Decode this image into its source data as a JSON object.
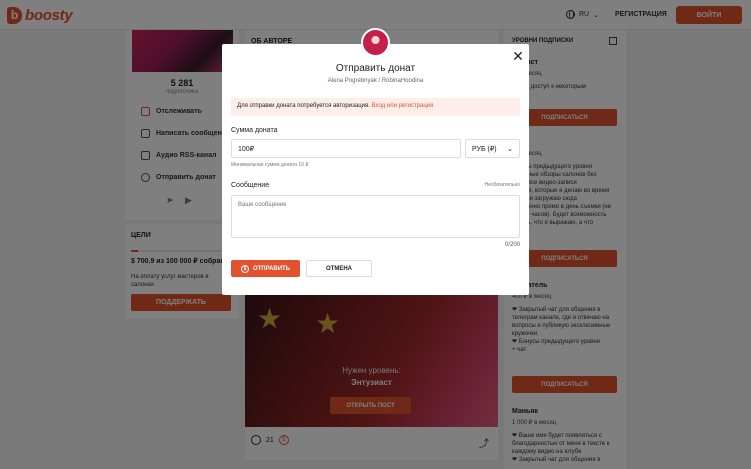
{
  "header": {
    "logo_text": "boosty",
    "language": "RU",
    "register_label": "РЕГИСТРАЦИЯ",
    "login_label": "ВОЙТИ"
  },
  "left": {
    "stat_number": "5 281",
    "stat_label": "подписчика",
    "actions": [
      "Отслеживать",
      "Написать сообщение",
      "Аудио RSS-канал",
      "Отправить донат"
    ]
  },
  "goals": {
    "title": "ЦЕЛИ",
    "amount": "$ 700.9 из 100 000 ₽ собрано",
    "progress_fraction": 0.07,
    "description": "На оплату услуг мастеров в салонах",
    "support_label": "ПОДДЕРЖАТЬ"
  },
  "center": {
    "about_title": "ОБ АВТОРЕ",
    "locked_title": "Нужен уровень:",
    "locked_level": "Энтузиаст",
    "open_post_label": "ОТКРЫТЬ ПОСТ",
    "comments_count": "21"
  },
  "right": {
    "title": "УРОВНИ ПОДПИСКИ",
    "tiers": [
      {
        "name": "…зиаст",
        "price": "… в месяц",
        "desc": "…ный доступ к некоторым"
      },
      {
        "name": "",
        "price": "… в месяц",
        "desc": "…нусы предыдущего уровня\n…ельные обзоры салонов без\n…ов, все видео-записи\n…ения, которые я делаю во время\n…дур и загружаю сюда\n…ственно прямо в день съемки (не\n…ее 4 часов). Будет возможность\n…нать, что я выражаю, а что\n…"
      },
      {
        "name": "…вватель",
        "price": "400 ₽ в месяц",
        "desc": "❤ Закрытый чат для общения в телеграм канале, где я отвечаю на вопросы и публикую эксклюзивные кружочки.\n❤ Бонусы предыдущего уровня\n+ чат"
      },
      {
        "name": "Маньяк",
        "price": "1 000 ₽ в месяц",
        "desc": "❤ Ваше имя будет появляться с благодарностью от меня в тексте к каждому видео на ютубе\n❤ Закрытый чат для общения в"
      }
    ],
    "subscribe_label": "ПОДПИСАТЬСЯ"
  },
  "modal": {
    "title": "Отправить донат",
    "subtitle": "Alena Pogrebnyak / RobinaHoodina",
    "alert_text": "Для отправки доната потребуется авторизация.",
    "alert_link": "Вход или регистрация",
    "amount_label": "Сумма доната",
    "amount_value": "100₽",
    "currency": "РУБ (₽)",
    "min_hint": "Минимальная сумма доната 10 ₽",
    "message_label": "Сообщение",
    "optional_label": "Необязательно",
    "message_placeholder": "Ваше сообщение",
    "counter": "0/200",
    "send_label": "ОТПРАВИТЬ",
    "cancel_label": "ОТМЕНА"
  },
  "colors": {
    "accent": "#e2522f",
    "alert_bg": "#fdeeea"
  }
}
